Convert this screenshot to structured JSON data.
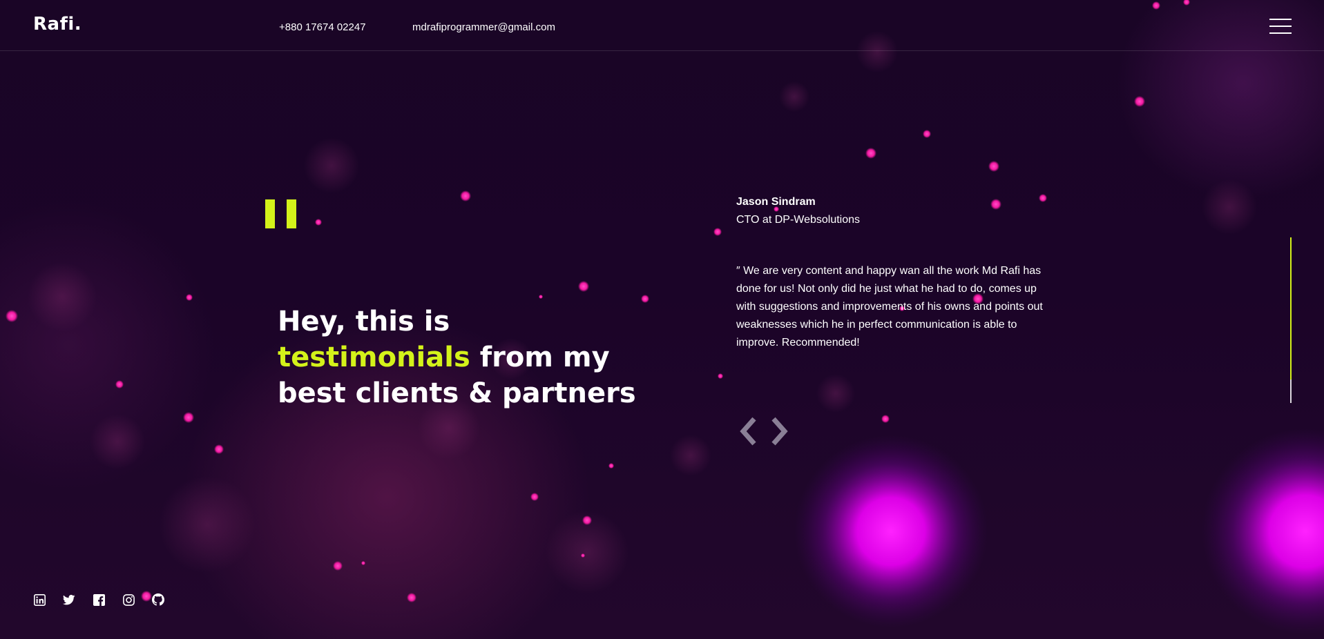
{
  "header": {
    "logo": "Rafi.",
    "phone": "+880 17674 02247",
    "email": "mdrafiprogrammer@gmail.com",
    "menu_icon": "hamburger-menu-icon"
  },
  "hero": {
    "quote_icon": "quote-mark-icon",
    "headline_part1": "Hey, this is",
    "headline_accent": "testimonials",
    "headline_part2": "from my best clients & partners"
  },
  "testimonial": {
    "name": "Jason Sindram",
    "role": "CTO at DP-Websolutions",
    "text": "″ We are very content and happy wan all the work Md Rafi has done for us! Not only did he just what he had to do, comes up with suggestions and improvements of his owns and points out weaknesses which he in perfect communication is able to improve. Recommended!",
    "prev_icon": "chevron-left-icon",
    "next_icon": "chevron-right-icon"
  },
  "slider": {
    "progress_fraction": 0.86
  },
  "social": [
    {
      "icon": "linkedin-icon"
    },
    {
      "icon": "twitter-icon"
    },
    {
      "icon": "facebook-icon"
    },
    {
      "icon": "instagram-icon"
    },
    {
      "icon": "github-icon"
    }
  ],
  "colors": {
    "accent": "#d4f21a",
    "background": "#1b0428",
    "particle": "#ff1aa8",
    "glow": "#ff00ff"
  }
}
